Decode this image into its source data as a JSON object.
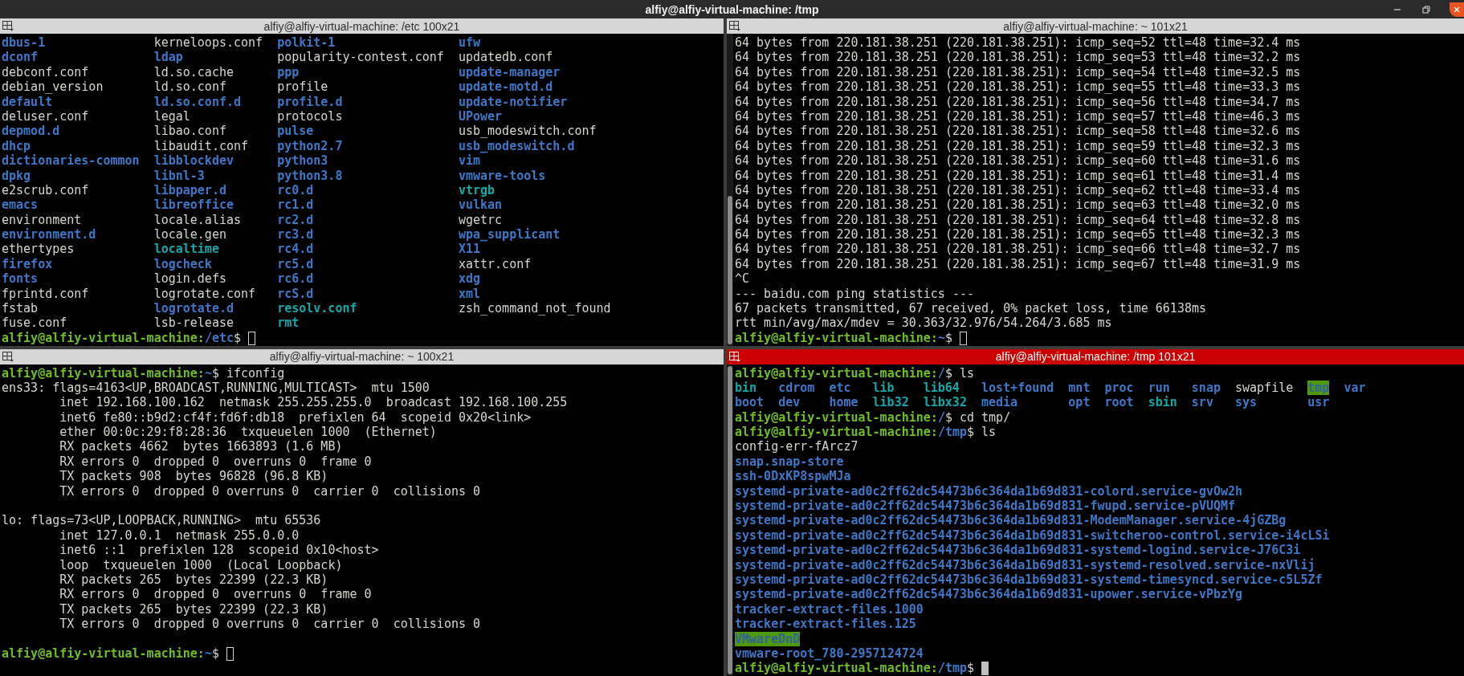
{
  "window": {
    "title": "alfiy@alfiy-virtual-machine: /tmp"
  },
  "panes": [
    {
      "title": "alfiy@alfiy-virtual-machine: /etc 100x21",
      "selected": false,
      "lines": [
        {
          "kind": "grid",
          "rows": [
            [
              {
                "text": "dbus-1",
                "kind": "dir"
              },
              {
                "text": "kerneloops.conf",
                "kind": "plain"
              },
              {
                "text": "polkit-1",
                "kind": "dir"
              },
              {
                "text": "ufw",
                "kind": "dir"
              }
            ],
            [
              {
                "text": "dconf",
                "kind": "dir"
              },
              {
                "text": "ldap",
                "kind": "dir"
              },
              {
                "text": "popularity-contest.conf",
                "kind": "plain"
              },
              {
                "text": "updatedb.conf",
                "kind": "plain"
              }
            ],
            [
              {
                "text": "debconf.conf",
                "kind": "plain"
              },
              {
                "text": "ld.so.cache",
                "kind": "plain"
              },
              {
                "text": "ppp",
                "kind": "dir"
              },
              {
                "text": "update-manager",
                "kind": "dir"
              }
            ],
            [
              {
                "text": "debian_version",
                "kind": "plain"
              },
              {
                "text": "ld.so.conf",
                "kind": "plain"
              },
              {
                "text": "profile",
                "kind": "plain"
              },
              {
                "text": "update-motd.d",
                "kind": "dir"
              }
            ],
            [
              {
                "text": "default",
                "kind": "dir"
              },
              {
                "text": "ld.so.conf.d",
                "kind": "dir"
              },
              {
                "text": "profile.d",
                "kind": "dir"
              },
              {
                "text": "update-notifier",
                "kind": "dir"
              }
            ],
            [
              {
                "text": "deluser.conf",
                "kind": "plain"
              },
              {
                "text": "legal",
                "kind": "plain"
              },
              {
                "text": "protocols",
                "kind": "plain"
              },
              {
                "text": "UPower",
                "kind": "dir"
              }
            ],
            [
              {
                "text": "depmod.d",
                "kind": "dir"
              },
              {
                "text": "libao.conf",
                "kind": "plain"
              },
              {
                "text": "pulse",
                "kind": "dir"
              },
              {
                "text": "usb_modeswitch.conf",
                "kind": "plain"
              }
            ],
            [
              {
                "text": "dhcp",
                "kind": "dir"
              },
              {
                "text": "libaudit.conf",
                "kind": "plain"
              },
              {
                "text": "python2.7",
                "kind": "dir"
              },
              {
                "text": "usb_modeswitch.d",
                "kind": "dir"
              }
            ],
            [
              {
                "text": "dictionaries-common",
                "kind": "dir"
              },
              {
                "text": "libblockdev",
                "kind": "dir"
              },
              {
                "text": "python3",
                "kind": "dir"
              },
              {
                "text": "vim",
                "kind": "dir"
              }
            ],
            [
              {
                "text": "dpkg",
                "kind": "dir"
              },
              {
                "text": "libnl-3",
                "kind": "dir"
              },
              {
                "text": "python3.8",
                "kind": "dir"
              },
              {
                "text": "vmware-tools",
                "kind": "dir"
              }
            ],
            [
              {
                "text": "e2scrub.conf",
                "kind": "plain"
              },
              {
                "text": "libpaper.d",
                "kind": "dir"
              },
              {
                "text": "rc0.d",
                "kind": "dir"
              },
              {
                "text": "vtrgb",
                "kind": "link"
              }
            ],
            [
              {
                "text": "emacs",
                "kind": "dir"
              },
              {
                "text": "libreoffice",
                "kind": "dir"
              },
              {
                "text": "rc1.d",
                "kind": "dir"
              },
              {
                "text": "vulkan",
                "kind": "dir"
              }
            ],
            [
              {
                "text": "environment",
                "kind": "plain"
              },
              {
                "text": "locale.alias",
                "kind": "plain"
              },
              {
                "text": "rc2.d",
                "kind": "dir"
              },
              {
                "text": "wgetrc",
                "kind": "plain"
              }
            ],
            [
              {
                "text": "environment.d",
                "kind": "dir"
              },
              {
                "text": "locale.gen",
                "kind": "plain"
              },
              {
                "text": "rc3.d",
                "kind": "dir"
              },
              {
                "text": "wpa_supplicant",
                "kind": "dir"
              }
            ],
            [
              {
                "text": "ethertypes",
                "kind": "plain"
              },
              {
                "text": "localtime",
                "kind": "link"
              },
              {
                "text": "rc4.d",
                "kind": "dir"
              },
              {
                "text": "X11",
                "kind": "dir"
              }
            ],
            [
              {
                "text": "firefox",
                "kind": "dir"
              },
              {
                "text": "logcheck",
                "kind": "dir"
              },
              {
                "text": "rc5.d",
                "kind": "dir"
              },
              {
                "text": "xattr.conf",
                "kind": "plain"
              }
            ],
            [
              {
                "text": "fonts",
                "kind": "dir"
              },
              {
                "text": "login.defs",
                "kind": "plain"
              },
              {
                "text": "rc6.d",
                "kind": "dir"
              },
              {
                "text": "xdg",
                "kind": "dir"
              }
            ],
            [
              {
                "text": "fprintd.conf",
                "kind": "plain"
              },
              {
                "text": "logrotate.conf",
                "kind": "plain"
              },
              {
                "text": "rcS.d",
                "kind": "dir"
              },
              {
                "text": "xml",
                "kind": "dir"
              }
            ],
            [
              {
                "text": "fstab",
                "kind": "plain"
              },
              {
                "text": "logrotate.d",
                "kind": "dir"
              },
              {
                "text": "resolv.conf",
                "kind": "link"
              },
              {
                "text": "zsh_command_not_found",
                "kind": "plain"
              }
            ],
            [
              {
                "text": "fuse.conf",
                "kind": "plain"
              },
              {
                "text": "lsb-release",
                "kind": "plain"
              },
              {
                "text": "rmt",
                "kind": "link"
              }
            ]
          ]
        },
        {
          "kind": "prompt",
          "user": "alfiy@alfiy-virtual-machine:",
          "path": "/etc",
          "command": "$"
        }
      ]
    },
    {
      "title": "alfiy@alfiy-virtual-machine: ~ 101x21",
      "selected": false,
      "lines": [
        {
          "kind": "plain",
          "text": "64 bytes from 220.181.38.251 (220.181.38.251): icmp_seq=52 ttl=48 time=32.4 ms"
        },
        {
          "kind": "plain",
          "text": "64 bytes from 220.181.38.251 (220.181.38.251): icmp_seq=53 ttl=48 time=32.2 ms"
        },
        {
          "kind": "plain",
          "text": "64 bytes from 220.181.38.251 (220.181.38.251): icmp_seq=54 ttl=48 time=32.5 ms"
        },
        {
          "kind": "plain",
          "text": "64 bytes from 220.181.38.251 (220.181.38.251): icmp_seq=55 ttl=48 time=33.3 ms"
        },
        {
          "kind": "plain",
          "text": "64 bytes from 220.181.38.251 (220.181.38.251): icmp_seq=56 ttl=48 time=34.7 ms"
        },
        {
          "kind": "plain",
          "text": "64 bytes from 220.181.38.251 (220.181.38.251): icmp_seq=57 ttl=48 time=46.3 ms"
        },
        {
          "kind": "plain",
          "text": "64 bytes from 220.181.38.251 (220.181.38.251): icmp_seq=58 ttl=48 time=32.6 ms"
        },
        {
          "kind": "plain",
          "text": "64 bytes from 220.181.38.251 (220.181.38.251): icmp_seq=59 ttl=48 time=32.3 ms"
        },
        {
          "kind": "plain",
          "text": "64 bytes from 220.181.38.251 (220.181.38.251): icmp_seq=60 ttl=48 time=31.6 ms"
        },
        {
          "kind": "plain",
          "text": "64 bytes from 220.181.38.251 (220.181.38.251): icmp_seq=61 ttl=48 time=31.4 ms"
        },
        {
          "kind": "plain",
          "text": "64 bytes from 220.181.38.251 (220.181.38.251): icmp_seq=62 ttl=48 time=33.4 ms"
        },
        {
          "kind": "plain",
          "text": "64 bytes from 220.181.38.251 (220.181.38.251): icmp_seq=63 ttl=48 time=32.0 ms"
        },
        {
          "kind": "plain",
          "text": "64 bytes from 220.181.38.251 (220.181.38.251): icmp_seq=64 ttl=48 time=32.8 ms"
        },
        {
          "kind": "plain",
          "text": "64 bytes from 220.181.38.251 (220.181.38.251): icmp_seq=65 ttl=48 time=32.3 ms"
        },
        {
          "kind": "plain",
          "text": "64 bytes from 220.181.38.251 (220.181.38.251): icmp_seq=66 ttl=48 time=32.7 ms"
        },
        {
          "kind": "plain",
          "text": "64 bytes from 220.181.38.251 (220.181.38.251): icmp_seq=67 ttl=48 time=31.9 ms"
        },
        {
          "kind": "plain",
          "text": "^C"
        },
        {
          "kind": "plain",
          "text": "--- baidu.com ping statistics ---"
        },
        {
          "kind": "plain",
          "text": "67 packets transmitted, 67 received, 0% packet loss, time 66138ms"
        },
        {
          "kind": "plain",
          "text": "rtt min/avg/max/mdev = 30.363/32.976/54.264/3.685 ms"
        },
        {
          "kind": "prompt",
          "user": "alfiy@alfiy-virtual-machine:",
          "path": "~",
          "command": "$"
        }
      ]
    },
    {
      "title": "alfiy@alfiy-virtual-machine: ~ 100x21",
      "selected": false,
      "lines": [
        {
          "kind": "prompt",
          "user": "alfiy@alfiy-virtual-machine:",
          "path": "~",
          "command": "$ ifconfig"
        },
        {
          "kind": "plain",
          "text": "ens33: flags=4163<UP,BROADCAST,RUNNING,MULTICAST>  mtu 1500"
        },
        {
          "kind": "plain",
          "text": "        inet 192.168.100.162  netmask 255.255.255.0  broadcast 192.168.100.255"
        },
        {
          "kind": "plain",
          "text": "        inet6 fe80::b9d2:cf4f:fd6f:db18  prefixlen 64  scopeid 0x20<link>"
        },
        {
          "kind": "plain",
          "text": "        ether 00:0c:29:f8:28:36  txqueuelen 1000  (Ethernet)"
        },
        {
          "kind": "plain",
          "text": "        RX packets 4662  bytes 1663893 (1.6 MB)"
        },
        {
          "kind": "plain",
          "text": "        RX errors 0  dropped 0  overruns 0  frame 0"
        },
        {
          "kind": "plain",
          "text": "        TX packets 908  bytes 96828 (96.8 KB)"
        },
        {
          "kind": "plain",
          "text": "        TX errors 0  dropped 0 overruns 0  carrier 0  collisions 0"
        },
        {
          "kind": "blank"
        },
        {
          "kind": "plain",
          "text": "lo: flags=73<UP,LOOPBACK,RUNNING>  mtu 65536"
        },
        {
          "kind": "plain",
          "text": "        inet 127.0.0.1  netmask 255.0.0.0"
        },
        {
          "kind": "plain",
          "text": "        inet6 ::1  prefixlen 128  scopeid 0x10<host>"
        },
        {
          "kind": "plain",
          "text": "        loop  txqueuelen 1000  (Local Loopback)"
        },
        {
          "kind": "plain",
          "text": "        RX packets 265  bytes 22399 (22.3 KB)"
        },
        {
          "kind": "plain",
          "text": "        RX errors 0  dropped 0  overruns 0  frame 0"
        },
        {
          "kind": "plain",
          "text": "        TX packets 265  bytes 22399 (22.3 KB)"
        },
        {
          "kind": "plain",
          "text": "        TX errors 0  dropped 0 overruns 0  carrier 0  collisions 0"
        },
        {
          "kind": "blank"
        },
        {
          "kind": "prompt",
          "user": "alfiy@alfiy-virtual-machine:",
          "path": "~",
          "command": "$"
        }
      ]
    },
    {
      "title": "alfiy@alfiy-virtual-machine: /tmp 101x21",
      "selected": true,
      "lines": [
        {
          "kind": "prompt",
          "user": "alfiy@alfiy-virtual-machine:",
          "path": "/",
          "command": "$ ls"
        },
        {
          "kind": "grid",
          "rows": [
            [
              {
                "text": "bin",
                "kind": "link"
              },
              {
                "text": "cdrom",
                "kind": "dir"
              },
              {
                "text": "etc",
                "kind": "dir"
              },
              {
                "text": "lib",
                "kind": "link"
              },
              {
                "text": "lib64",
                "kind": "link"
              },
              {
                "text": "lost+found",
                "kind": "dir"
              },
              {
                "text": "mnt",
                "kind": "dir"
              },
              {
                "text": "proc",
                "kind": "dir"
              },
              {
                "text": "run",
                "kind": "dir"
              },
              {
                "text": "snap",
                "kind": "dir"
              },
              {
                "text": "swapfile",
                "kind": "plain"
              },
              {
                "text": "tmp",
                "kind": "sticky"
              },
              {
                "text": "var",
                "kind": "dir"
              }
            ],
            [
              {
                "text": "boot",
                "kind": "dir"
              },
              {
                "text": "dev",
                "kind": "dir"
              },
              {
                "text": "home",
                "kind": "dir"
              },
              {
                "text": "lib32",
                "kind": "link"
              },
              {
                "text": "libx32",
                "kind": "link"
              },
              {
                "text": "media",
                "kind": "dir"
              },
              {
                "text": "opt",
                "kind": "dir"
              },
              {
                "text": "root",
                "kind": "dir"
              },
              {
                "text": "sbin",
                "kind": "link"
              },
              {
                "text": "srv",
                "kind": "dir"
              },
              {
                "text": "sys",
                "kind": "dir"
              },
              {
                "text": "usr",
                "kind": "dir"
              }
            ]
          ]
        },
        {
          "kind": "prompt",
          "user": "alfiy@alfiy-virtual-machine:",
          "path": "/",
          "command": "$ cd tmp/"
        },
        {
          "kind": "prompt",
          "user": "alfiy@alfiy-virtual-machine:",
          "path": "/tmp",
          "command": "$ ls"
        },
        {
          "kind": "plain",
          "text": "config-err-fArcz7"
        },
        {
          "kind": "dir",
          "text": "snap.snap-store"
        },
        {
          "kind": "dir",
          "text": "ssh-0DxKP8spwMJa"
        },
        {
          "kind": "dir",
          "text": "systemd-private-ad0c2ff62dc54473b6c364da1b69d831-colord.service-gvOw2h"
        },
        {
          "kind": "dir",
          "text": "systemd-private-ad0c2ff62dc54473b6c364da1b69d831-fwupd.service-pVUQMf"
        },
        {
          "kind": "dir",
          "text": "systemd-private-ad0c2ff62dc54473b6c364da1b69d831-ModemManager.service-4jGZBg"
        },
        {
          "kind": "dir",
          "text": "systemd-private-ad0c2ff62dc54473b6c364da1b69d831-switcheroo-control.service-i4cLSi"
        },
        {
          "kind": "dir",
          "text": "systemd-private-ad0c2ff62dc54473b6c364da1b69d831-systemd-logind.service-J76C3i"
        },
        {
          "kind": "dir",
          "text": "systemd-private-ad0c2ff62dc54473b6c364da1b69d831-systemd-resolved.service-nxVlij"
        },
        {
          "kind": "dir",
          "text": "systemd-private-ad0c2ff62dc54473b6c364da1b69d831-systemd-timesyncd.service-c5L5Zf"
        },
        {
          "kind": "dir",
          "text": "systemd-private-ad0c2ff62dc54473b6c364da1b69d831-upower.service-vPbzYg"
        },
        {
          "kind": "dir",
          "text": "tracker-extract-files.1000"
        },
        {
          "kind": "dir",
          "text": "tracker-extract-files.125"
        },
        {
          "kind": "sticky",
          "text": "VMwareDnD"
        },
        {
          "kind": "dir",
          "text": "vmware-root_780-2957124724"
        },
        {
          "kind": "prompt",
          "user": "alfiy@alfiy-virtual-machine:",
          "path": "/tmp",
          "command": "$"
        }
      ]
    }
  ]
}
